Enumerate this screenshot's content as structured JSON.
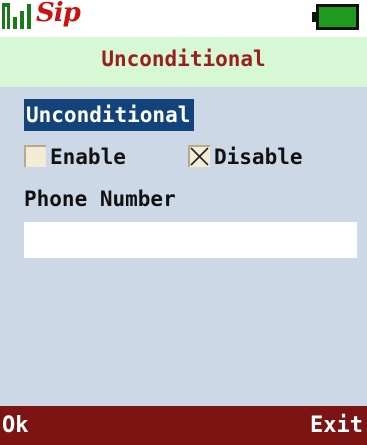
{
  "statusbar": {
    "signal_icon": "signal-strength-icon",
    "sip_label": "Sip",
    "battery_icon": "battery-full-icon",
    "battery_color": "#1e9a1e"
  },
  "title": "Unconditional",
  "form": {
    "section_label": "Unconditional",
    "options": [
      {
        "label": "Enable",
        "checked": false
      },
      {
        "label": "Disable",
        "checked": true
      }
    ],
    "phone_label": "Phone Number",
    "phone_value": ""
  },
  "softkeys": {
    "left": "Ok",
    "right": "Exit"
  },
  "colors": {
    "title_bg": "#d7f8d4",
    "title_text": "#9a1e1e",
    "content_bg": "#ccd8e6",
    "highlight_bg": "#12437a",
    "softkey_bg": "#7c1414"
  }
}
